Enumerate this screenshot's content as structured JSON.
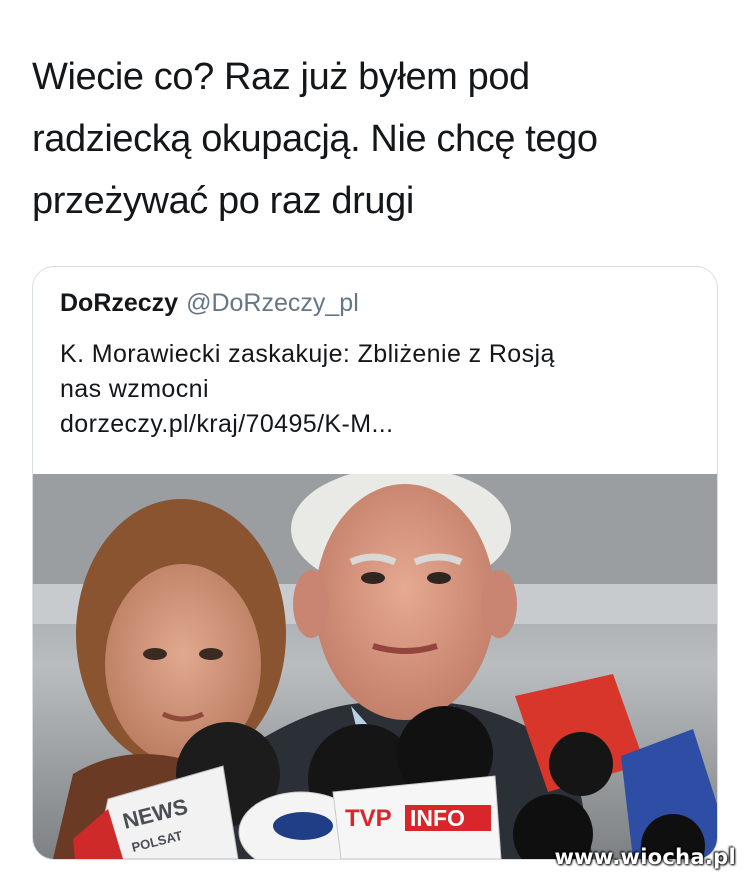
{
  "tweet": {
    "lines": [
      "Wiecie co? Raz już byłem pod",
      "radziecką okupacją. Nie chcę tego",
      "przeżywać po raz drugi"
    ]
  },
  "quote": {
    "author_name": "DoRzeczy",
    "author_handle": "@DoRzeczy_pl",
    "headline_lines": [
      "K. Morawiecki zaskakuje: Zbliżenie z Rosją",
      "nas wzmocni"
    ],
    "link": "dorzeczy.pl/kraj/70495/K-M..."
  },
  "photo": {
    "mic_labels": {
      "news": "NEWS",
      "news_sub": "POLSAT",
      "tvp": "TVP",
      "info": "INFO"
    }
  },
  "watermark": "www.wiocha.pl",
  "colors": {
    "text": "#14171a",
    "secondary": "#657786",
    "card_border": "#d8dde1",
    "tvp_red": "#d9262a"
  }
}
